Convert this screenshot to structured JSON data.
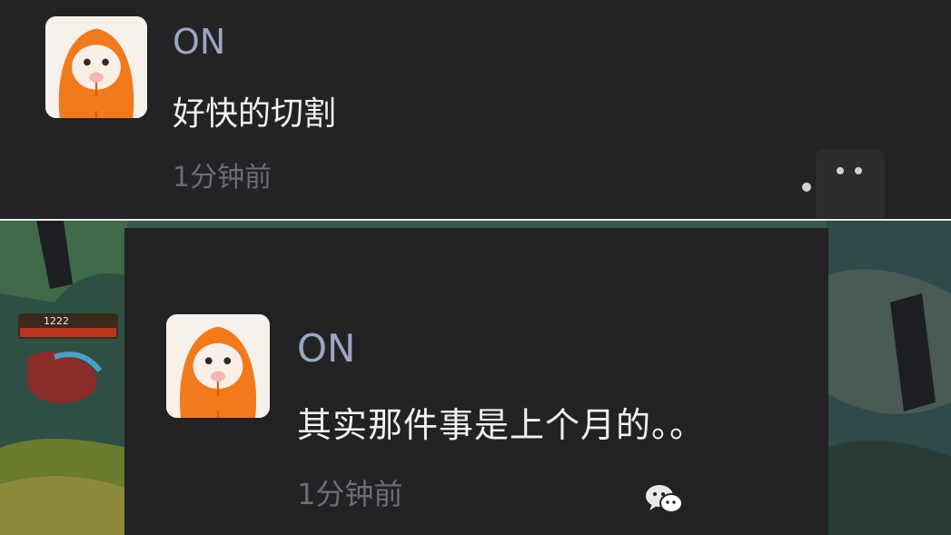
{
  "top_notification": {
    "sender": "ON",
    "message": "好快的切割",
    "time": "1分钟前",
    "avatar_icon": "orange-hooded-character-icon"
  },
  "bottom_notification": {
    "sender": "ON",
    "message": "其实那件事是上个月的。。",
    "time": "1分钟前",
    "avatar_icon": "orange-hooded-character-icon"
  },
  "game_hud": {
    "hp_value": "1222"
  },
  "watermark": {
    "icon": "wechat-icon"
  },
  "colors": {
    "panel_bg": "#232325",
    "name_color": "#9da6c0",
    "message_color": "#f1f1f1",
    "time_color": "#6b6d72"
  }
}
